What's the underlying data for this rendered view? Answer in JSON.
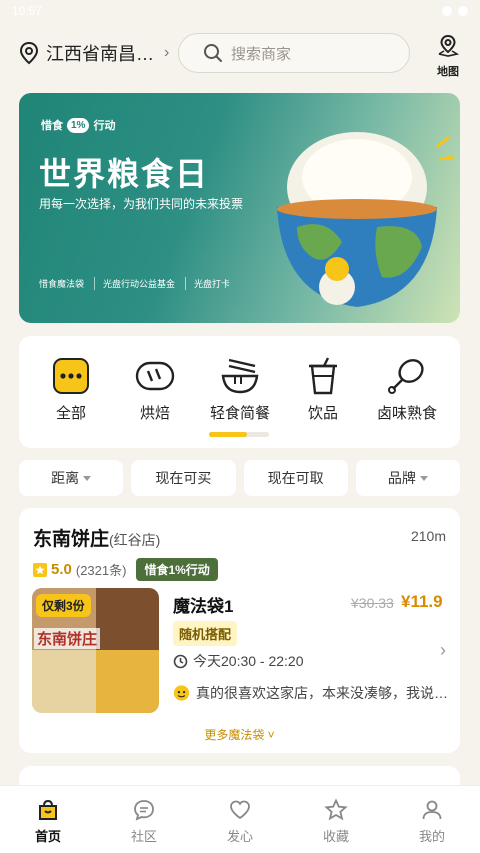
{
  "status_bar": {
    "time": "10:57"
  },
  "header": {
    "location": "江西省南昌…",
    "search_placeholder": "搜索商家",
    "map_label": "地图"
  },
  "banner": {
    "brand_tag": "惜食",
    "brand_pct": "1%",
    "brand_action": "行动",
    "title": "世界粮食日",
    "subtitle": "用每一次选择，为我们共同的未来投票",
    "logos": [
      "惜食魔法袋",
      "光盘行动公益基金",
      "光盘打卡"
    ],
    "page_count": 8,
    "active_page": 1
  },
  "categories": {
    "items": [
      {
        "label": "全部",
        "icon": "all-icon"
      },
      {
        "label": "烘焙",
        "icon": "bread-icon"
      },
      {
        "label": "轻食简餐",
        "icon": "noodle-bowl-icon"
      },
      {
        "label": "饮品",
        "icon": "drink-cup-icon"
      },
      {
        "label": "卤味熟食",
        "icon": "drumstick-icon"
      }
    ],
    "scroll_progress": 0.63
  },
  "filters": [
    {
      "label": "距离",
      "has_dropdown": true
    },
    {
      "label": "现在可买",
      "has_dropdown": false
    },
    {
      "label": "现在可取",
      "has_dropdown": false
    },
    {
      "label": "品牌",
      "has_dropdown": true
    }
  ],
  "store": {
    "name": "东南饼庄",
    "branch": "(红谷店)",
    "distance": "210m",
    "rating": "5.0",
    "review_count": "(2321条)",
    "campaign_badge": "惜食1%行动",
    "thumbnail_badge": "仅剩3份",
    "thumbnail_text": "东南饼庄",
    "bag_name": "魔法袋1",
    "original_price": "¥30.33",
    "price": "¥11.9",
    "bag_tag": "随机搭配",
    "pickup_time": "今天20:30 - 22:20",
    "review_snippet": "真的很喜欢这家店，本来没凑够，我说…",
    "more_label": "更多魔法袋"
  },
  "tabbar": [
    {
      "label": "首页",
      "icon": "home-bag-icon",
      "active": true
    },
    {
      "label": "社区",
      "icon": "chat-bubble-icon",
      "active": false
    },
    {
      "label": "发心",
      "icon": "heart-icon",
      "active": false
    },
    {
      "label": "收藏",
      "icon": "star-icon",
      "active": false
    },
    {
      "label": "我的",
      "icon": "profile-icon",
      "active": false
    }
  ],
  "colors": {
    "accent": "#f7c518",
    "price": "#d98a00",
    "campaign_green": "#4d6f3a",
    "banner_teal": "#1f8577"
  }
}
